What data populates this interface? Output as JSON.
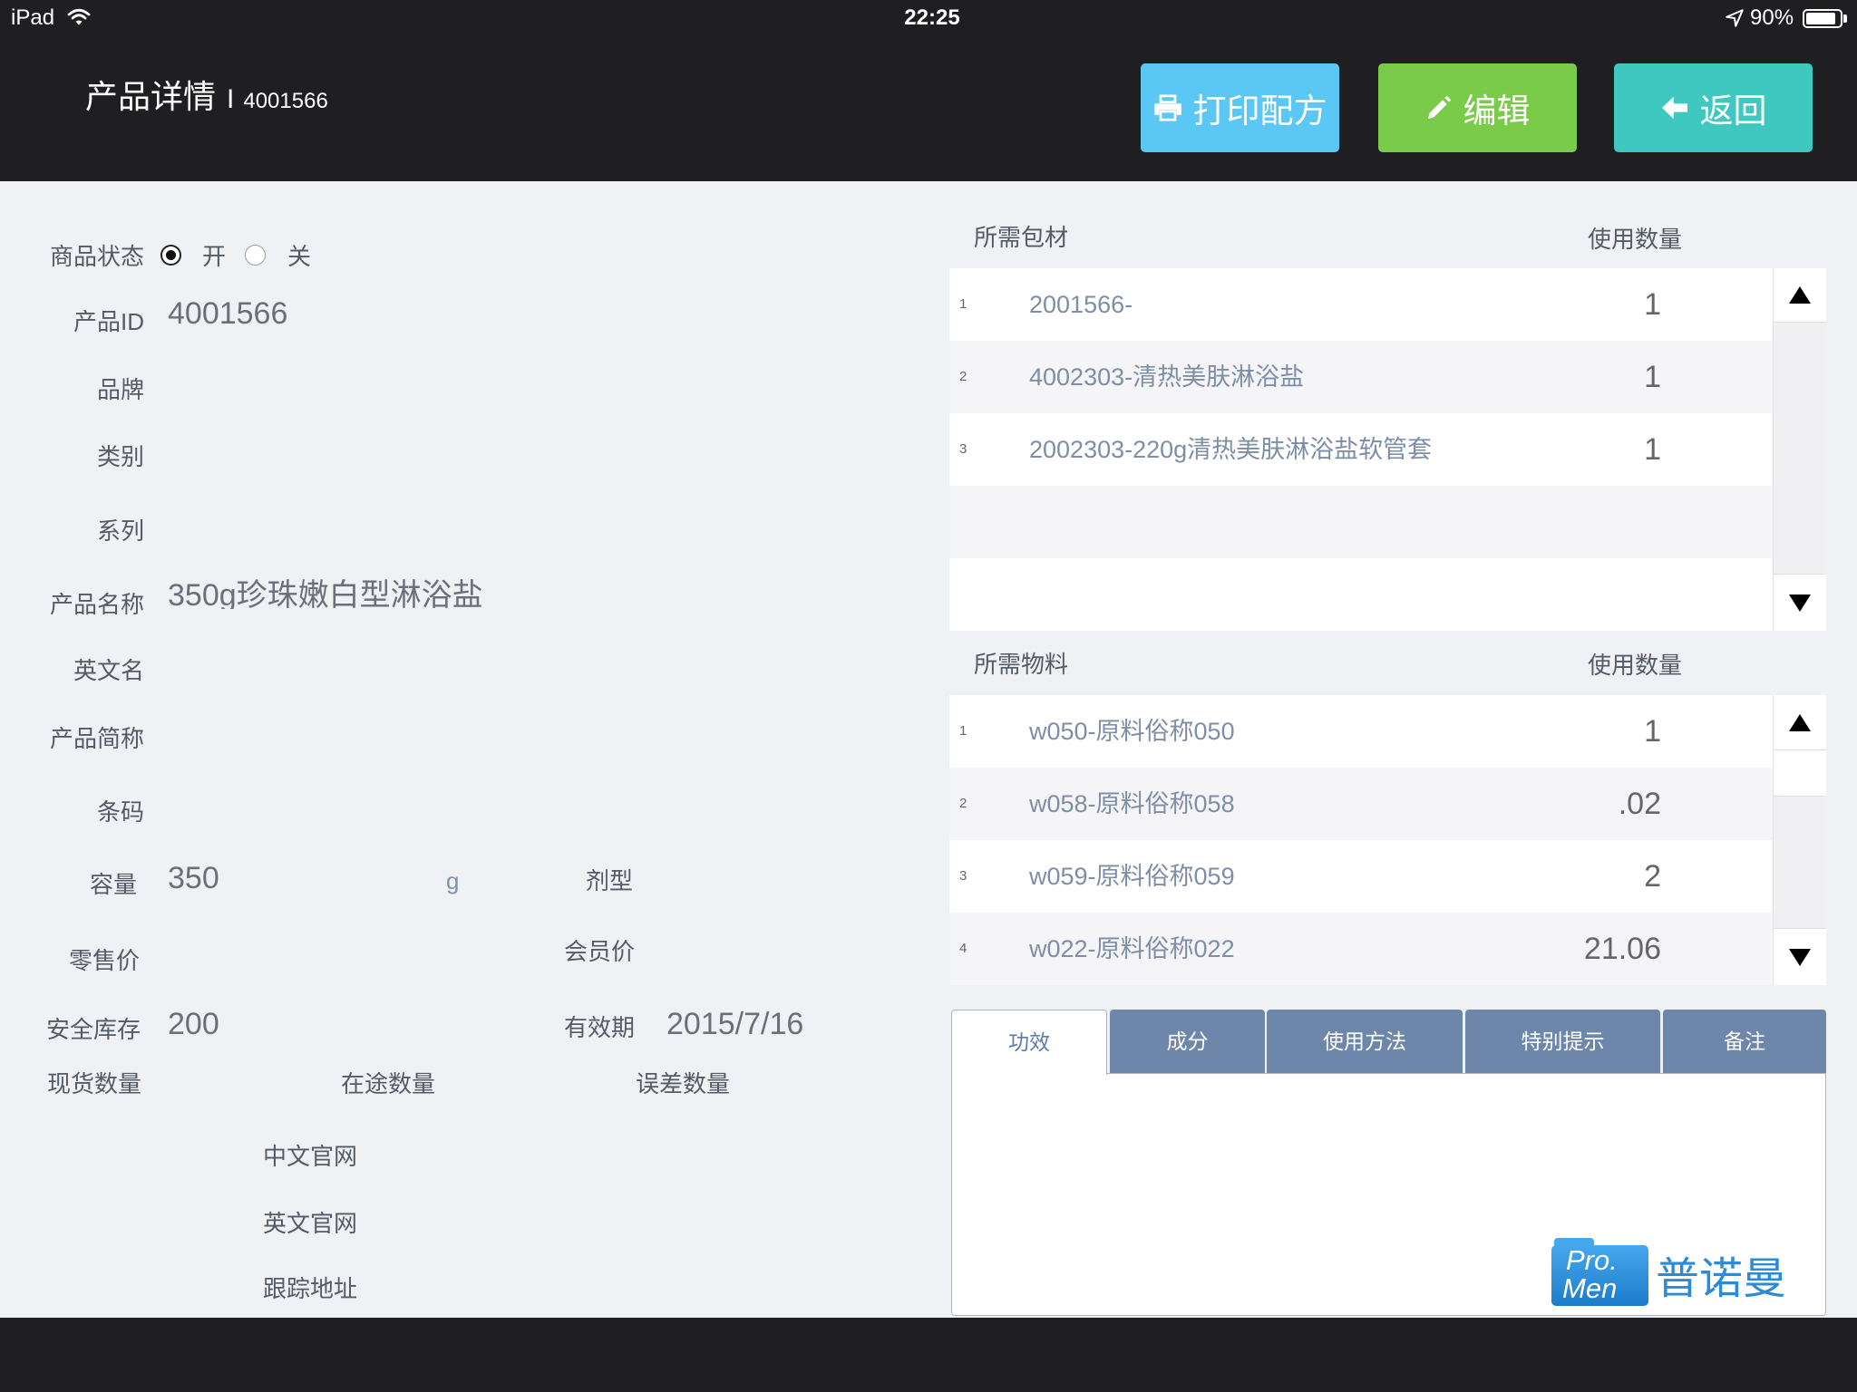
{
  "status_bar": {
    "device": "iPad",
    "time": "22:25",
    "battery": "90%",
    "battery_level": 0.9
  },
  "header": {
    "title": "产品详情",
    "separator": "I",
    "product_id": "4001566",
    "buttons": {
      "print": "打印配方",
      "edit": "编辑",
      "back": "返回"
    }
  },
  "colors": {
    "print_button": "#5bc7f4",
    "edit_button": "#7bcb4b",
    "back_button": "#3ec8c0",
    "tab_inactive": "#6e86a9",
    "tab_active_text": "#5b7bab"
  },
  "icons": {
    "wifi": "wifi-icon",
    "location": "location-arrow-icon",
    "battery": "battery-icon",
    "print": "printer-icon",
    "edit": "pencil-icon",
    "back": "arrow-left-icon",
    "scroll_up": "triangle-up-icon",
    "scroll_down": "triangle-down-icon"
  },
  "form": {
    "status": {
      "label": "商品状态",
      "options": [
        "开",
        "关"
      ],
      "selected_index": 0
    },
    "product_id": {
      "label": "产品ID",
      "value": "4001566"
    },
    "brand": {
      "label": "品牌"
    },
    "category": {
      "label": "类别"
    },
    "series": {
      "label": "系列"
    },
    "product_name": {
      "label": "产品名称",
      "value": "350g珍珠嫩白型淋浴盐"
    },
    "english_name": {
      "label": "英文名"
    },
    "short_name": {
      "label": "产品简称"
    },
    "barcode": {
      "label": "条码"
    },
    "capacity": {
      "label": "容量",
      "value": "350",
      "unit": "g"
    },
    "dosage_form": {
      "label": "剂型"
    },
    "retail_price": {
      "label": "零售价"
    },
    "member_price": {
      "label": "会员价"
    },
    "safety_stock": {
      "label": "安全库存",
      "value": "200"
    },
    "expiry_date": {
      "label": "有效期",
      "value": "2015/7/16"
    },
    "stock_qty": {
      "label": "现货数量"
    },
    "in_transit_qty": {
      "label": "在途数量"
    },
    "error_qty": {
      "label": "误差数量"
    },
    "cn_website": {
      "label": "中文官网"
    },
    "en_website": {
      "label": "英文官网"
    },
    "tracking_url": {
      "label": "跟踪地址"
    }
  },
  "packaging": {
    "title": "所需包材",
    "qty_header": "使用数量",
    "rows": [
      {
        "no": "1",
        "name": "2001566-",
        "qty": "1"
      },
      {
        "no": "2",
        "name": "4002303-清热美肤淋浴盐",
        "qty": "1"
      },
      {
        "no": "3",
        "name": "2002303-220g清热美肤淋浴盐软管套",
        "qty": "1"
      }
    ]
  },
  "materials": {
    "title": "所需物料",
    "qty_header": "使用数量",
    "rows": [
      {
        "no": "1",
        "name": "w050-原料俗称050",
        "qty": "1"
      },
      {
        "no": "2",
        "name": "w058-原料俗称058",
        "qty": ".02"
      },
      {
        "no": "3",
        "name": "w059-原料俗称059",
        "qty": "2"
      },
      {
        "no": "4",
        "name": "w022-原料俗称022",
        "qty": "21.06"
      }
    ]
  },
  "tabs": {
    "items": [
      "功效",
      "成分",
      "使用方法",
      "特别提示",
      "备注"
    ],
    "active_index": 0
  },
  "logo": {
    "line1": "Pro.",
    "line2": "Men",
    "name": "普诺曼"
  }
}
